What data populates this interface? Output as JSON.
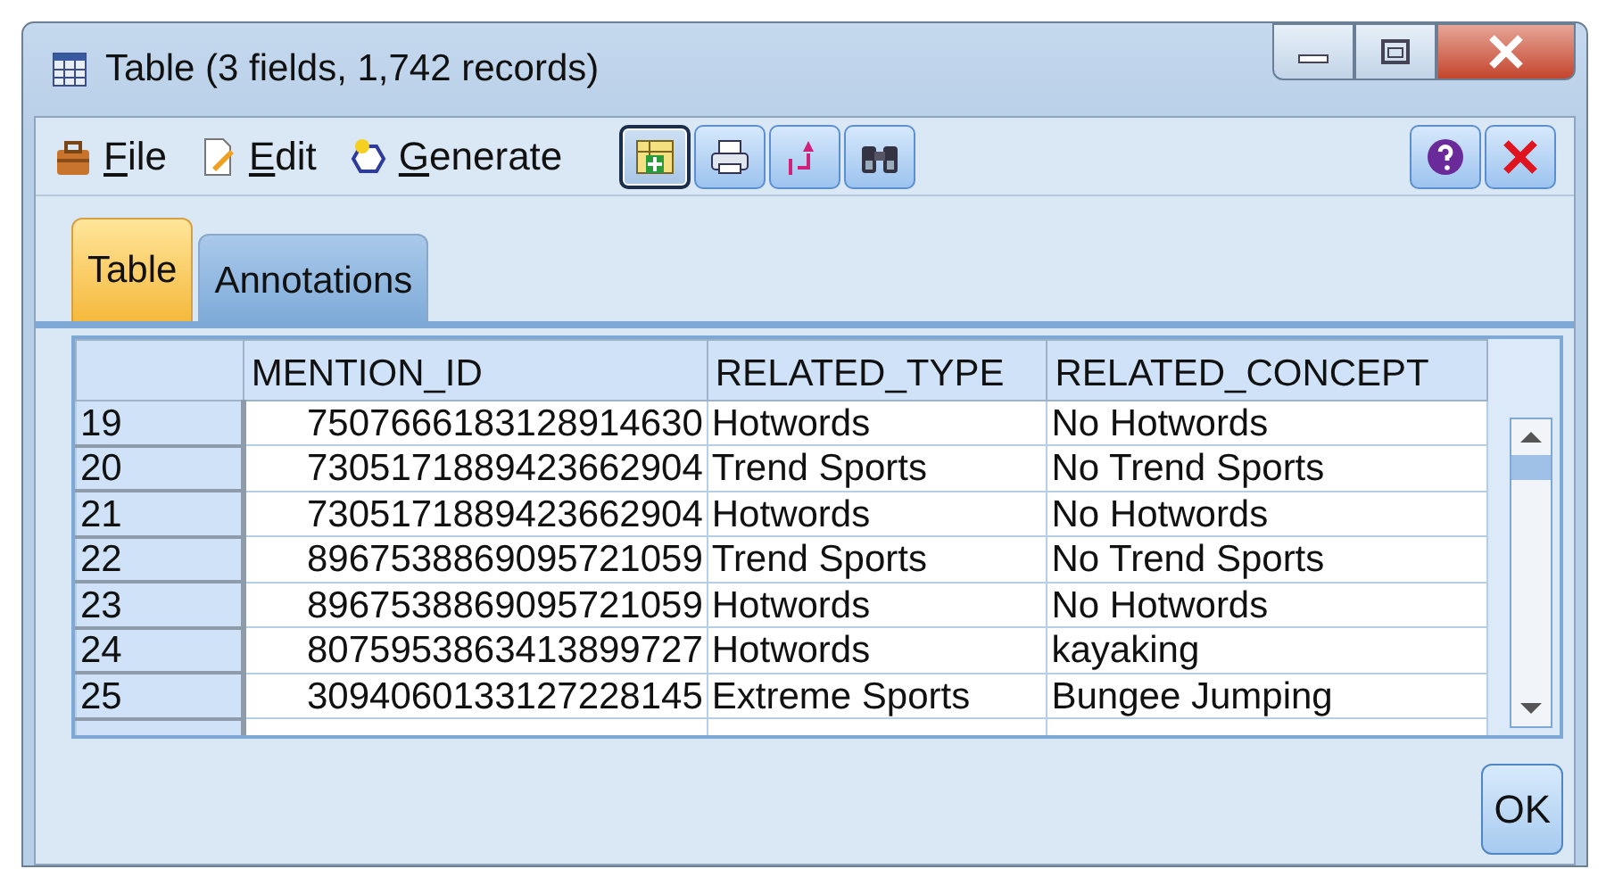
{
  "window": {
    "title": "Table (3 fields, 1,742 records)"
  },
  "menu": [
    {
      "label": "File",
      "kind": "file"
    },
    {
      "label": "Edit",
      "kind": "edit"
    },
    {
      "label": "Generate",
      "kind": "generate"
    }
  ],
  "toolbar_buttons": [
    {
      "kind": "table",
      "pressed": true
    },
    {
      "kind": "print",
      "pressed": false
    },
    {
      "kind": "sort",
      "pressed": false
    },
    {
      "kind": "find",
      "pressed": false
    }
  ],
  "tabs": [
    {
      "label": "Table",
      "selected": true
    },
    {
      "label": "Annotations",
      "selected": false
    }
  ],
  "table": {
    "columns": [
      "MENTION_ID",
      "RELATED_TYPE",
      "RELATED_CONCEPT"
    ],
    "rows": [
      {
        "row": "19",
        "cells": [
          "7507666183128914630",
          "Hotwords",
          "No Hotwords"
        ]
      },
      {
        "row": "20",
        "cells": [
          "7305171889423662904",
          "Trend Sports",
          "No Trend Sports"
        ]
      },
      {
        "row": "21",
        "cells": [
          "7305171889423662904",
          "Hotwords",
          "No Hotwords"
        ]
      },
      {
        "row": "22",
        "cells": [
          "8967538869095721059",
          "Trend Sports",
          "No Trend Sports"
        ]
      },
      {
        "row": "23",
        "cells": [
          "8967538869095721059",
          "Hotwords",
          "No Hotwords"
        ]
      },
      {
        "row": "24",
        "cells": [
          "8075953863413899727",
          "Hotwords",
          "kayaking"
        ]
      },
      {
        "row": "25",
        "cells": [
          "3094060133127228145",
          "Extreme Sports",
          "Bungee Jumping"
        ]
      }
    ]
  },
  "buttons": [
    {
      "label": "OK"
    }
  ]
}
